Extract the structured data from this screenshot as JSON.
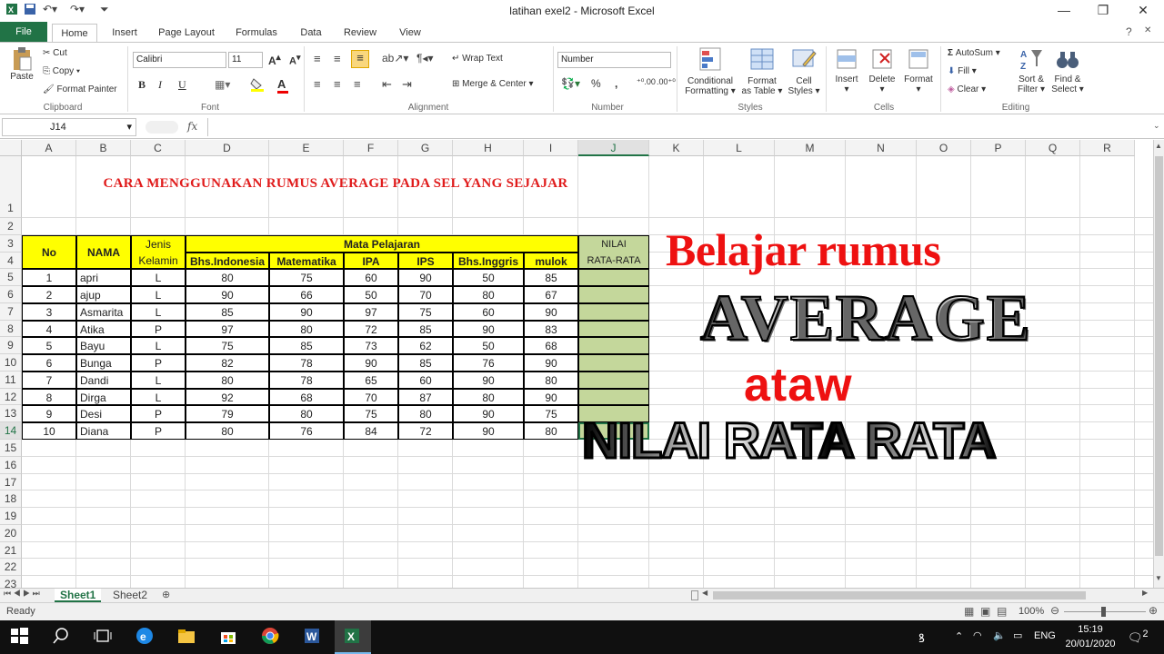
{
  "window": {
    "title": "latihan exel2  -  Microsoft Excel"
  },
  "tabs": [
    "File",
    "Home",
    "Insert",
    "Page Layout",
    "Formulas",
    "Data",
    "Review",
    "View"
  ],
  "ribbon": {
    "clipboard": {
      "paste": "Paste",
      "cut": "Cut",
      "copy": "Copy",
      "format_painter": "Format Painter",
      "label": "Clipboard"
    },
    "font": {
      "name": "Calibri",
      "size": "11",
      "label": "Font",
      "bold": "B",
      "italic": "I",
      "underline": "U"
    },
    "alignment": {
      "wrap": "Wrap Text",
      "merge": "Merge & Center",
      "label": "Alignment"
    },
    "number": {
      "format": "Number",
      "label": "Number",
      "percent": "%",
      "comma": ","
    },
    "styles": {
      "conditional": "Conditional",
      "conditional2": "Formatting",
      "format_as": "Format",
      "format_as2": "as Table",
      "cell": "Cell",
      "cell2": "Styles",
      "label": "Styles"
    },
    "cells": {
      "insert": "Insert",
      "delete": "Delete",
      "format": "Format",
      "label": "Cells"
    },
    "editing": {
      "autosum": "AutoSum",
      "fill": "Fill",
      "clear": "Clear",
      "sort": "Sort &",
      "sort2": "Filter",
      "find": "Find &",
      "find2": "Select",
      "label": "Editing"
    }
  },
  "formula_bar": {
    "name_box": "J14",
    "fx": "fx",
    "formula": ""
  },
  "columns": [
    "A",
    "B",
    "C",
    "D",
    "E",
    "F",
    "G",
    "H",
    "I",
    "J",
    "K",
    "L",
    "M",
    "N",
    "O",
    "P",
    "Q",
    "R"
  ],
  "rows": [
    "1",
    "2",
    "3",
    "4",
    "5",
    "6",
    "7",
    "8",
    "9",
    "10",
    "11",
    "12",
    "13",
    "14",
    "15",
    "16",
    "17",
    "18",
    "19",
    "20",
    "21",
    "22",
    "23"
  ],
  "sheet": {
    "title": "CARA MENGGUNAKAN RUMUS AVERAGE PADA SEL YANG SEJAJAR",
    "headers": {
      "no": "No",
      "nama": "NAMA",
      "jenis1": "Jenis",
      "jenis2": "Kelamin",
      "mata": "Mata Pelajaran",
      "nilai1": "NILAI",
      "nilai2": "RATA-RATA",
      "subjects": [
        "Bhs.Indonesia",
        "Matematika",
        "IPA",
        "IPS",
        "Bhs.Inggris",
        "mulok"
      ]
    },
    "data": [
      [
        "1",
        "apri",
        "L",
        "80",
        "75",
        "60",
        "90",
        "50",
        "85"
      ],
      [
        "2",
        "ajup",
        "L",
        "90",
        "66",
        "50",
        "70",
        "80",
        "67"
      ],
      [
        "3",
        "Asmarita",
        "L",
        "85",
        "90",
        "97",
        "75",
        "60",
        "90"
      ],
      [
        "4",
        "Atika",
        "P",
        "97",
        "80",
        "72",
        "85",
        "90",
        "83"
      ],
      [
        "5",
        "Bayu",
        "L",
        "75",
        "85",
        "73",
        "62",
        "50",
        "68"
      ],
      [
        "6",
        "Bunga",
        "P",
        "82",
        "78",
        "90",
        "85",
        "76",
        "90"
      ],
      [
        "7",
        "Dandi",
        "L",
        "80",
        "78",
        "65",
        "60",
        "90",
        "80"
      ],
      [
        "8",
        "Dirga",
        "L",
        "92",
        "68",
        "70",
        "87",
        "80",
        "90"
      ],
      [
        "9",
        "Desi",
        "P",
        "79",
        "80",
        "75",
        "80",
        "90",
        "75"
      ],
      [
        "10",
        "Diana",
        "P",
        "80",
        "76",
        "84",
        "72",
        "90",
        "80"
      ]
    ]
  },
  "overlay": {
    "line1": "Belajar rumus",
    "line2": "AVERAGE",
    "line3": "ataw",
    "line4": "NILAI RATA RATA"
  },
  "sheet_tabs": [
    "Sheet1",
    "Sheet2"
  ],
  "status": {
    "ready": "Ready",
    "zoom": "100%"
  },
  "taskbar": {
    "lang": "ENG",
    "time": "15:19",
    "date": "20/01/2020",
    "notif": "2"
  },
  "colors": {
    "excel_green": "#217346",
    "header_yellow": "#ffff00",
    "average_green": "#c4d79b",
    "title_red": "#e01b1b"
  }
}
